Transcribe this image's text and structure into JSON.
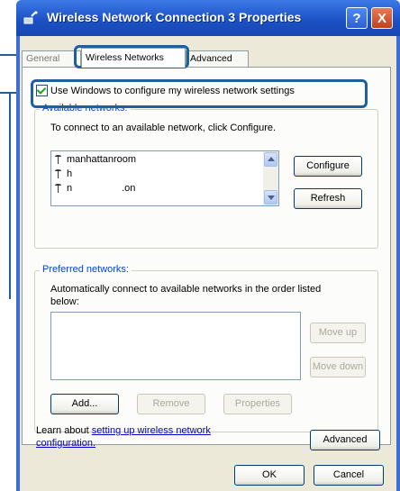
{
  "window": {
    "title": "Wireless Network Connection 3 Properties",
    "help_label": "?",
    "close_label": "X"
  },
  "tabs": [
    {
      "label": "General"
    },
    {
      "label": "Wireless Networks"
    },
    {
      "label": "Advanced"
    }
  ],
  "checkbox": {
    "label": "Use Windows to configure my wireless network settings",
    "checked": true
  },
  "available": {
    "legend": "Available networks:",
    "instruction": "To connect to an available network, click Configure.",
    "networks": [
      {
        "name": "manhattanroom"
      },
      {
        "name": "h"
      },
      {
        "name": "n                  .on"
      }
    ],
    "configure_label": "Configure",
    "refresh_label": "Refresh"
  },
  "preferred": {
    "legend": "Preferred networks:",
    "instruction_line1": "Automatically connect to available networks in the order listed",
    "instruction_line2": "below:",
    "move_up_label": "Move up",
    "move_down_label": "Move down",
    "add_label": "Add...",
    "remove_label": "Remove",
    "properties_label": "Properties"
  },
  "footer": {
    "learn_prefix": "Learn about",
    "learn_link_1": "setting up wireless network",
    "learn_link_2": "configuration.",
    "advanced_label": "Advanced",
    "ok_label": "OK",
    "cancel_label": "Cancel"
  },
  "colors": {
    "titlebar": "#1c52c5",
    "callout": "#1f5f9a",
    "dialog_bg": "#ece9d8"
  }
}
